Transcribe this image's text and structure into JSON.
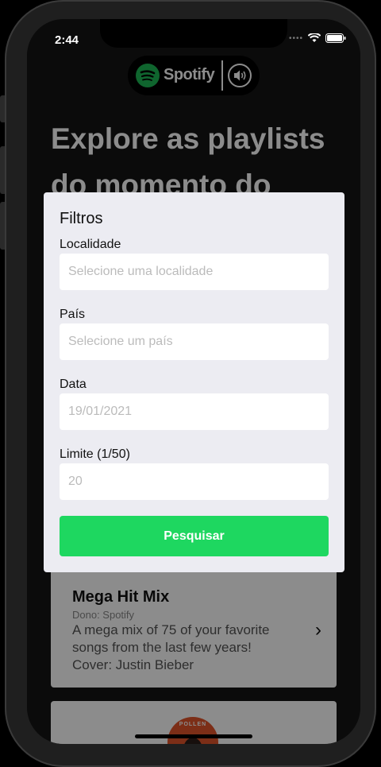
{
  "status_bar": {
    "time": "2:44"
  },
  "brand": {
    "name": "Spotify"
  },
  "page": {
    "heading": "Explore as playlists do momento do"
  },
  "playlist_card": {
    "title": "Mega Hit Mix",
    "owner": "Dono: Spotify",
    "description": "A mega mix of 75 of your favorite songs from the last few years! Cover: Justin Bieber",
    "chevron": "›"
  },
  "next_card": {
    "cover_text": "POLLEN"
  },
  "filters": {
    "title": "Filtros",
    "locality": {
      "label": "Localidade",
      "placeholder": "Selecione uma localidade"
    },
    "country": {
      "label": "País",
      "placeholder": "Selecione um país"
    },
    "date": {
      "label": "Data",
      "placeholder": "19/01/2021"
    },
    "limit": {
      "label": "Limite (1/50)",
      "placeholder": "20"
    },
    "search_button": "Pesquisar"
  },
  "colors": {
    "accent": "#1ed760",
    "spotify_green": "#1DB954"
  }
}
